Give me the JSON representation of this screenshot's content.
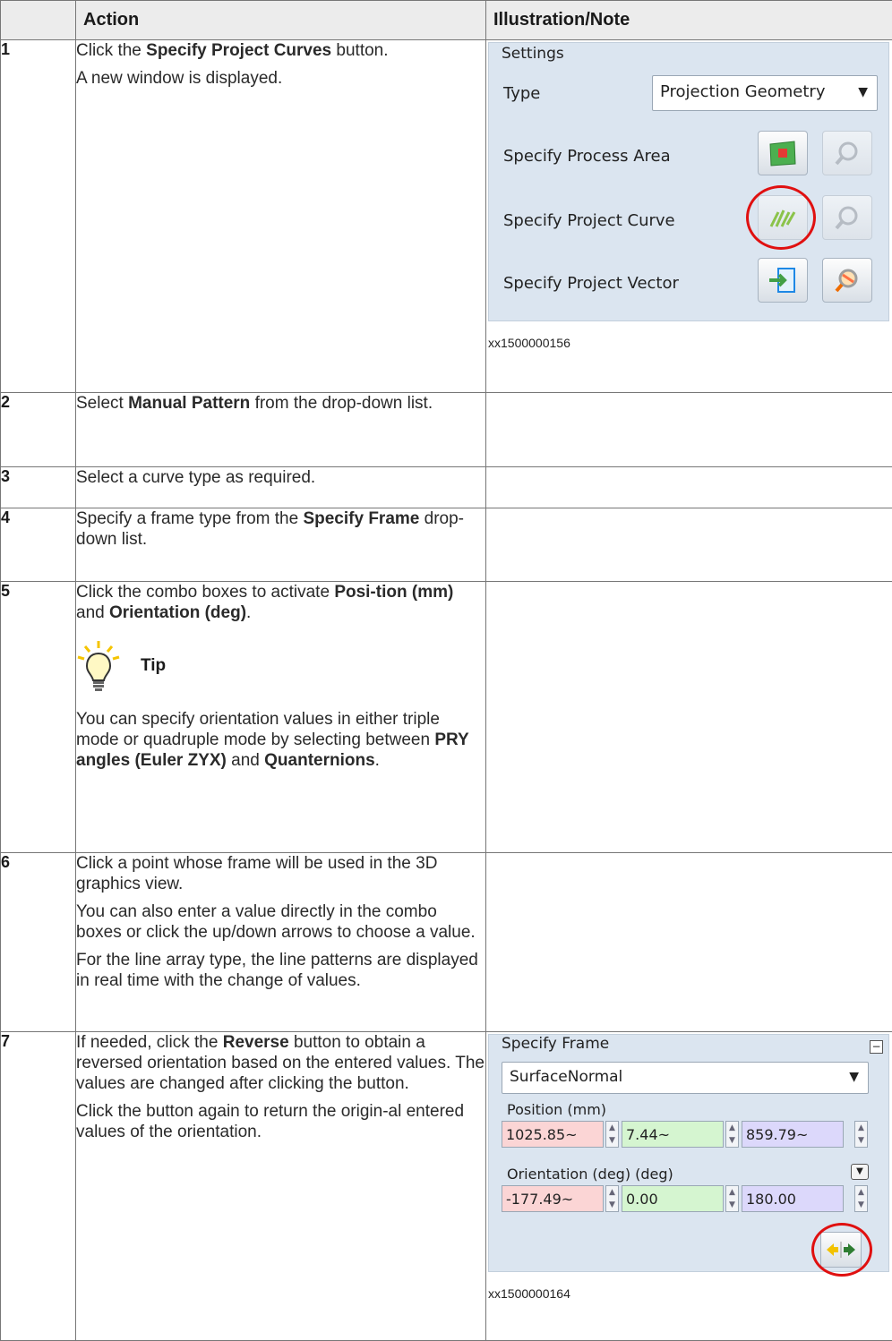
{
  "header": {
    "step_col": "",
    "action_col": "Action",
    "note_col": "Illustration/Note"
  },
  "steps": [
    {
      "num": "1"
    },
    {
      "num": "2"
    },
    {
      "num": "3"
    },
    {
      "num": "4"
    },
    {
      "num": "5"
    },
    {
      "num": "6"
    },
    {
      "num": "7"
    }
  ],
  "step1": {
    "a": "Click the ",
    "b": "Specify Project Curves",
    "c": " button.",
    "line2": "A new window is displayed."
  },
  "step2": {
    "a": "Select ",
    "b": "Manual Pattern",
    "c": " from the drop-down list."
  },
  "step3": {
    "text": "Select a curve type as required."
  },
  "step4": {
    "a": "Specify a frame type from the ",
    "b": "Specify Frame",
    "c": " drop-down list."
  },
  "step5": {
    "a": "Click the combo boxes to activate ",
    "b": "Posi-tion (mm)",
    "c": " and ",
    "d": "Orientation (deg)",
    "e": ".",
    "tip_title": "Tip",
    "tip_a": "You can specify orientation values in either triple mode or quadruple mode by selecting between ",
    "tip_b": "PRY angles (Euler ZYX)",
    "tip_c": " and ",
    "tip_d": "Quanternions",
    "tip_e": "."
  },
  "step6": {
    "p1": "Click a point whose frame will be used in the 3D graphics view.",
    "p2": "You can also enter a value directly in the combo boxes or click the up/down arrows to choose a value.",
    "p3": "For the line array type, the line patterns are displayed in real time with the change of values."
  },
  "step7": {
    "a": "If needed, click the ",
    "b": "Reverse",
    "c": " button to obtain a reversed orientation based on the entered values. The values are changed after clicking the button.",
    "p2": "Click the button again to return the origin-al entered values of the orientation."
  },
  "settings_panel": {
    "legend": "Settings",
    "type_label": "Type",
    "type_value": "Projection Geometry",
    "process_area_label": "Specify Process Area",
    "project_curve_label": "Specify Project Curve",
    "project_vector_label": "Specify Project Vector",
    "caption": "xx1500000156"
  },
  "frame_panel": {
    "legend": "Specify Frame",
    "frame_value": "SurfaceNormal",
    "position_label": "Position (mm)",
    "pos_x": "1025.85~",
    "pos_y": "7.44~",
    "pos_z": "859.79~",
    "orientation_label": "Orientation (deg) (deg)",
    "ori_x": "-177.49~",
    "ori_y": "0.00",
    "ori_z": "180.00",
    "caption": "xx1500000164"
  },
  "colors": {
    "header_bg": "#ececec",
    "panel_bg": "#dbe5f0",
    "highlight": "#e01010"
  }
}
